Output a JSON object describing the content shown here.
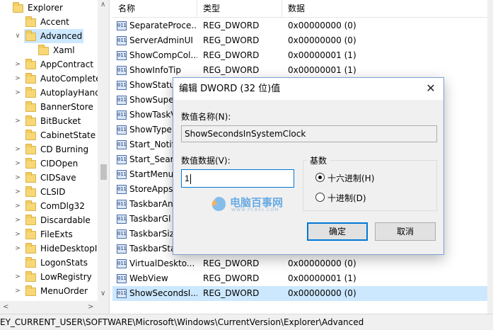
{
  "tree": {
    "items": [
      {
        "label": "Explorer",
        "twig": "",
        "selected": false
      },
      {
        "label": "Accent",
        "twig": "",
        "selected": false
      },
      {
        "label": "Advanced",
        "twig": "∨",
        "selected": true
      },
      {
        "label": "Xaml",
        "twig": "",
        "selected": false
      },
      {
        "label": "AppContract",
        "twig": ">",
        "selected": false
      },
      {
        "label": "AutoComplete",
        "twig": ">",
        "selected": false
      },
      {
        "label": "AutoplayHand",
        "twig": ">",
        "selected": false
      },
      {
        "label": "BannerStore",
        "twig": "",
        "selected": false
      },
      {
        "label": "BitBucket",
        "twig": ">",
        "selected": false
      },
      {
        "label": "CabinetState",
        "twig": "",
        "selected": false
      },
      {
        "label": "CD Burning",
        "twig": ">",
        "selected": false
      },
      {
        "label": "CIDOpen",
        "twig": ">",
        "selected": false
      },
      {
        "label": "CIDSave",
        "twig": ">",
        "selected": false
      },
      {
        "label": "CLSID",
        "twig": ">",
        "selected": false
      },
      {
        "label": "ComDlg32",
        "twig": ">",
        "selected": false
      },
      {
        "label": "Discardable",
        "twig": ">",
        "selected": false
      },
      {
        "label": "FileExts",
        "twig": ">",
        "selected": false
      },
      {
        "label": "HideDesktopI",
        "twig": ">",
        "selected": false
      },
      {
        "label": "LogonStats",
        "twig": "",
        "selected": false
      },
      {
        "label": "LowRegistry",
        "twig": ">",
        "selected": false
      },
      {
        "label": "MenuOrder",
        "twig": ">",
        "selected": false
      }
    ]
  },
  "list": {
    "headers": {
      "name": "名称",
      "type": "类型",
      "data": "数据"
    },
    "icon_text": "ab\n10",
    "rows": [
      {
        "name": "SeparateProce...",
        "type": "REG_DWORD",
        "data": "0x00000000 (0)",
        "selected": false
      },
      {
        "name": "ServerAdminUI",
        "type": "REG_DWORD",
        "data": "0x00000000 (0)",
        "selected": false
      },
      {
        "name": "ShowCompCol...",
        "type": "REG_DWORD",
        "data": "0x00000001 (1)",
        "selected": false
      },
      {
        "name": "ShowInfoTip",
        "type": "REG_DWORD",
        "data": "0x00000001 (1)",
        "selected": false
      },
      {
        "name": "ShowStatus",
        "type": "",
        "data": "",
        "selected": false
      },
      {
        "name": "ShowSuper",
        "type": "",
        "data": "",
        "selected": false
      },
      {
        "name": "ShowTaskV",
        "type": "",
        "data": "",
        "selected": false
      },
      {
        "name": "ShowType",
        "type": "",
        "data": "",
        "selected": false
      },
      {
        "name": "Start_Notif",
        "type": "",
        "data": "",
        "selected": false
      },
      {
        "name": "Start_Searc",
        "type": "",
        "data": "",
        "selected": false
      },
      {
        "name": "StartMenu",
        "type": "",
        "data": "",
        "selected": false
      },
      {
        "name": "StoreApps",
        "type": "",
        "data": "",
        "selected": false
      },
      {
        "name": "TaskbarAn",
        "type": "",
        "data": "",
        "selected": false
      },
      {
        "name": "TaskbarGl",
        "type": "",
        "data": "",
        "selected": false
      },
      {
        "name": "TaskbarSiz",
        "type": "",
        "data": "",
        "selected": false
      },
      {
        "name": "TaskbarSta",
        "type": "",
        "data": "",
        "selected": false
      },
      {
        "name": "VirtualDeskto...",
        "type": "REG_DWORD",
        "data": "0x00000000 (0)",
        "selected": false
      },
      {
        "name": "WebView",
        "type": "REG_DWORD",
        "data": "0x00000001 (1)",
        "selected": false
      },
      {
        "name": "ShowSecondsI...",
        "type": "REG_DWORD",
        "data": "0x00000000 (0)",
        "selected": true
      }
    ]
  },
  "status_bar": {
    "path": "EY_CURRENT_USER\\SOFTWARE\\Microsoft\\Windows\\CurrentVersion\\Explorer\\Advanced"
  },
  "dialog": {
    "title": "编辑 DWORD (32 位)值",
    "value_name_label": "数值名称(N):",
    "value_name": "ShowSecondsInSystemClock",
    "value_data_label": "数值数据(V):",
    "value_data": "1",
    "base_label": "基数",
    "hex_label": "十六进制(H)",
    "dec_label": "十进制(D)",
    "selected_base": "hex",
    "ok_label": "确定",
    "cancel_label": "取消"
  },
  "watermark": {
    "text": "电脑百事网",
    "sub": "WWW.PC841.COM"
  },
  "colors": {
    "selection": "#cce8ff",
    "accent": "#0078d7",
    "folder": "#f7d777"
  }
}
